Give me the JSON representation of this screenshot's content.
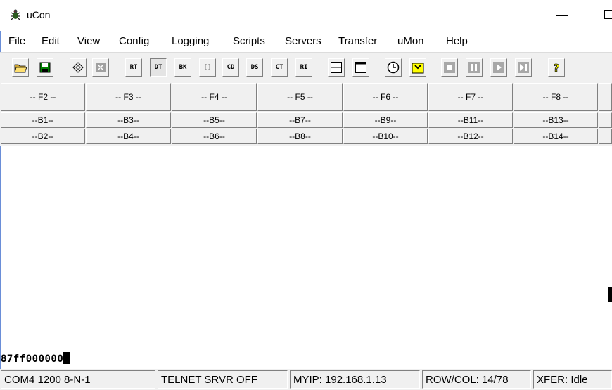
{
  "window": {
    "title": "uCon"
  },
  "menu": [
    "File",
    "Edit",
    "View",
    "Config",
    "Logging",
    "Scripts",
    "Servers",
    "Transfer",
    "uMon",
    "Help"
  ],
  "toolbar": {
    "buttons": [
      {
        "name": "open-icon"
      },
      {
        "name": "save-icon"
      },
      {
        "name": "wizard-icon"
      },
      {
        "name": "disabled-arrows-icon"
      },
      {
        "name": "rts-icon",
        "glyph": "RT"
      },
      {
        "name": "dtr-icon",
        "glyph": "DT"
      },
      {
        "name": "brk-icon",
        "glyph": "BK"
      },
      {
        "name": "brackets-icon",
        "glyph": "[]"
      },
      {
        "name": "cd-icon",
        "glyph": "CD"
      },
      {
        "name": "dsr-icon",
        "glyph": "DS"
      },
      {
        "name": "cts-icon",
        "glyph": "CT"
      },
      {
        "name": "ri-icon",
        "glyph": "RI"
      },
      {
        "name": "split-view-icon"
      },
      {
        "name": "single-view-icon"
      },
      {
        "name": "clock-icon"
      },
      {
        "name": "yellow-folder-icon"
      },
      {
        "name": "stop-icon"
      },
      {
        "name": "pause-icon"
      },
      {
        "name": "play-icon"
      },
      {
        "name": "step-icon"
      },
      {
        "name": "help-icon"
      }
    ]
  },
  "function_keys": [
    "-- F2 --",
    "-- F3 --",
    "-- F4 --",
    "-- F5 --",
    "-- F6 --",
    "-- F7 --",
    "-- F8 --"
  ],
  "button_row1": [
    "--B1--",
    "--B3--",
    "--B5--",
    "--B7--",
    "--B9--",
    "--B11--",
    "--B13--"
  ],
  "button_row2": [
    "--B2--",
    "--B4--",
    "--B6--",
    "--B8--",
    "--B10--",
    "--B12--",
    "--B14--"
  ],
  "terminal": {
    "text": "87ff000000"
  },
  "status": {
    "port": "COM4 1200 8-N-1",
    "telnet": "TELNET SRVR OFF",
    "myip": "MYIP: 192.168.1.13",
    "rowcol": "ROW/COL: 14/78",
    "xfer": "XFER: Idle"
  },
  "colors": {
    "face": "#f0f0f0",
    "highlight_yellow": "#ffff00",
    "save_green": "#008000"
  }
}
